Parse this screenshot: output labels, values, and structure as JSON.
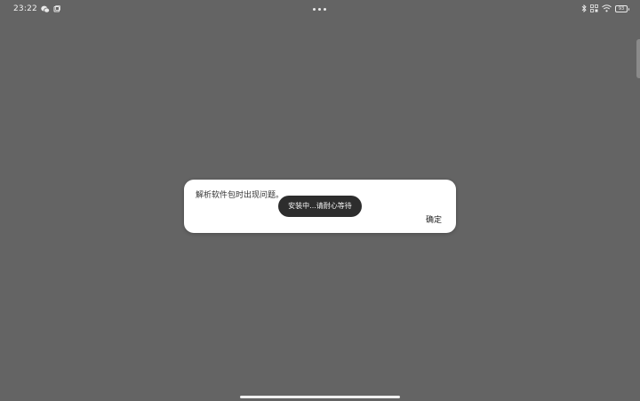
{
  "status_bar": {
    "time": "23:22",
    "left_icons": [
      "wechat-icon",
      "notification-square-icon"
    ],
    "right_icons": [
      "bluetooth-icon",
      "nfc-icon",
      "wifi-icon"
    ],
    "battery_level": "93"
  },
  "dialog": {
    "message": "解析软件包时出现问题。",
    "confirm_label": "确定"
  },
  "toast": {
    "text": "安装中...请耐心等待"
  },
  "colors": {
    "backdrop": "#646464",
    "dialog_bg": "#ffffff",
    "toast_bg": "#2d2d2d"
  }
}
